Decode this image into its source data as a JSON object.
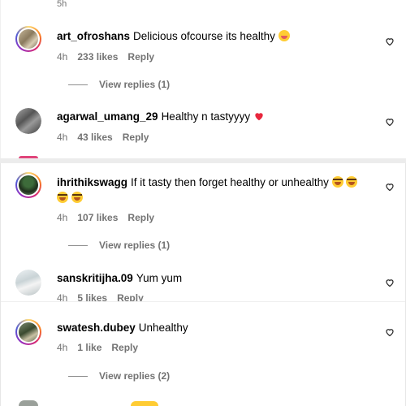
{
  "top_cut_time": "5h",
  "comments": [
    {
      "username": "art_ofroshans",
      "text": "Delicious ofcourse its healthy",
      "time": "4h",
      "likes": "233 likes",
      "reply": "Reply",
      "view_replies": "View replies (1)"
    },
    {
      "username": "agarwal_umang_29",
      "text": "Healthy n tastyyyy",
      "time": "4h",
      "likes": "43 likes",
      "reply": "Reply"
    },
    {
      "username": "ihrithikswagg",
      "text": "If it tasty then forget healthy or unhealthy",
      "time": "4h",
      "likes": "107 likes",
      "reply": "Reply",
      "view_replies": "View replies (1)"
    },
    {
      "username": "sanskritijha.09",
      "text": "Yum yum",
      "time": "4h",
      "likes": "5 likes",
      "reply": "Reply"
    },
    {
      "username": "swatesh.dubey",
      "text": "Unhealthy",
      "time": "4h",
      "likes": "1 like",
      "reply": "Reply",
      "view_replies": "View replies (2)"
    }
  ],
  "colors": {
    "meta": "#737373",
    "heart_stroke": "#262626",
    "ring_start": "#feda75",
    "ring_end": "#4f5bd5"
  }
}
